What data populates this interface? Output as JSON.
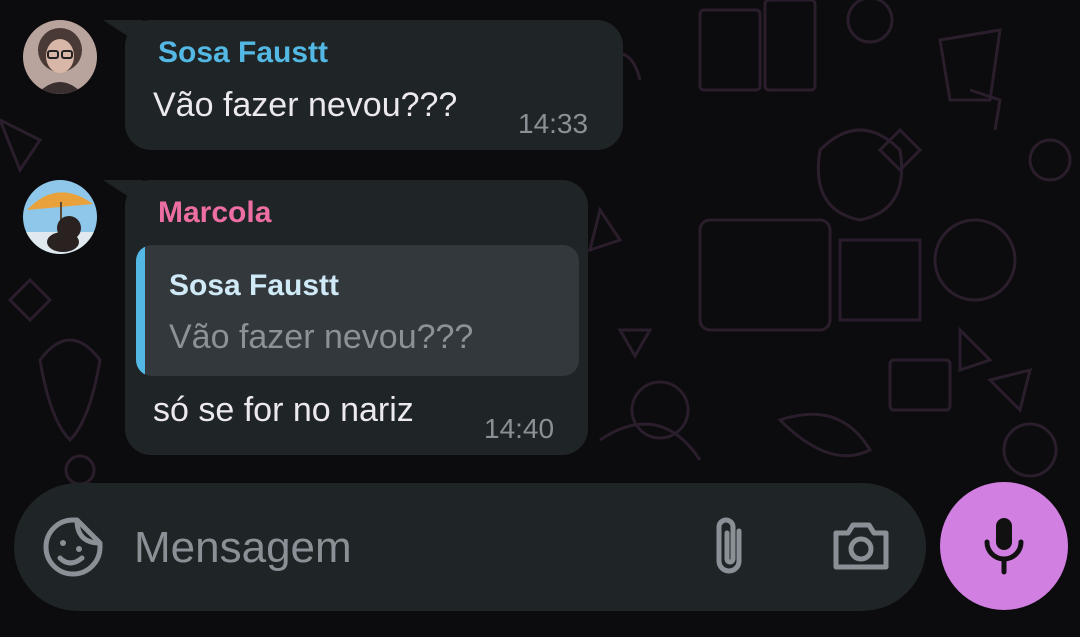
{
  "colors": {
    "background": "#0c0b0d",
    "bubble": "#1f2426",
    "quote_bg": "#32383b",
    "accent_mic": "#d27fe2",
    "sender_sosa": "#53b8e3",
    "sender_marcola": "#ec6ea3"
  },
  "messages": [
    {
      "sender": "Sosa Faustt",
      "text": "Vão fazer nevou???",
      "time": "14:33",
      "avatar_icon": "profile-photo-woman-glasses"
    },
    {
      "sender": "Marcola",
      "quote": {
        "sender": "Sosa Faustt",
        "text": "Vão fazer nevou???"
      },
      "text": "só se for no nariz",
      "time": "14:40",
      "avatar_icon": "profile-photo-umbrella-beach"
    }
  ],
  "composer": {
    "placeholder": "Mensagem",
    "emoji_icon": "sticker-smiley-icon",
    "attach_icon": "paperclip-icon",
    "camera_icon": "camera-icon",
    "mic_icon": "microphone-icon"
  }
}
